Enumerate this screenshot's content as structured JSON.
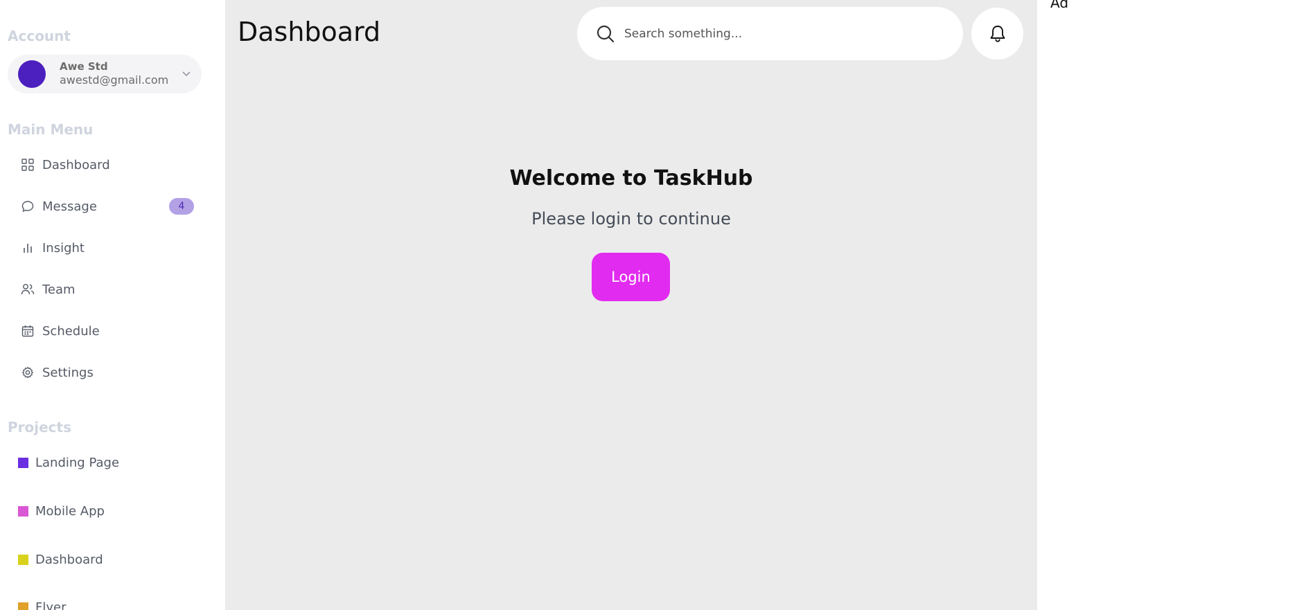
{
  "sidebar": {
    "account_title": "Account",
    "account": {
      "name": "Awe Std",
      "email": "awestd@gmail.com"
    },
    "main_menu_title": "Main Menu",
    "menu": [
      {
        "label": "Dashboard",
        "icon": "grid-icon"
      },
      {
        "label": "Message",
        "icon": "chat-icon",
        "badge": "4"
      },
      {
        "label": "Insight",
        "icon": "bar-chart-icon"
      },
      {
        "label": "Team",
        "icon": "users-icon"
      },
      {
        "label": "Schedule",
        "icon": "calendar-icon"
      },
      {
        "label": "Settings",
        "icon": "gear-icon"
      }
    ],
    "projects_title": "Projects",
    "projects": [
      {
        "label": "Landing Page",
        "color": "#6a2ee0"
      },
      {
        "label": "Mobile App",
        "color": "#d957d4"
      },
      {
        "label": "Dashboard",
        "color": "#d8d21d"
      },
      {
        "label": "Flyer",
        "color": "#e0a02a"
      }
    ]
  },
  "header": {
    "title": "Dashboard",
    "search_placeholder": "Search something..."
  },
  "main": {
    "welcome": "Welcome to TaskHub",
    "subtitle": "Please login to continue",
    "login_label": "Login"
  },
  "right_panel": {
    "text": "Ad"
  },
  "colors": {
    "accent": "#e22bf0",
    "avatar": "#4c1fbf",
    "badge_bg": "#b3a1e6"
  }
}
